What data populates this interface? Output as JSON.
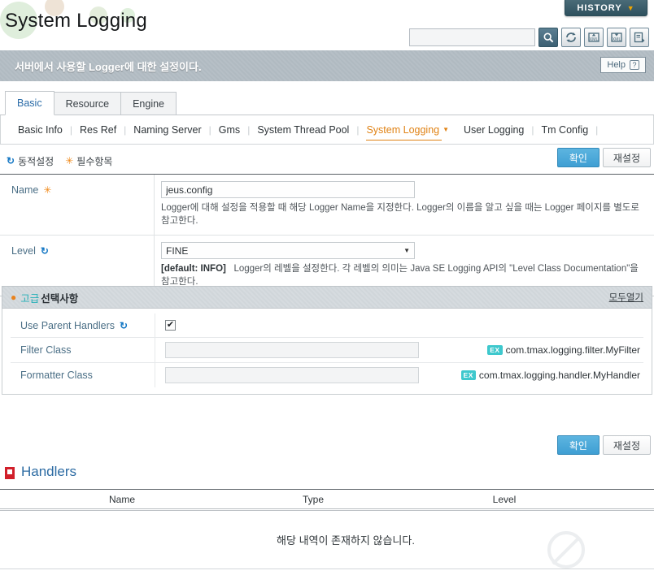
{
  "header": {
    "title": "System Logging",
    "history_label": "HISTORY",
    "history_caret": "▼",
    "search_placeholder": "",
    "search_value": "",
    "toolbar_icons": [
      {
        "name": "search-icon",
        "title": "Search"
      },
      {
        "name": "refresh-icon",
        "title": "Reload"
      },
      {
        "name": "xml-upload-icon",
        "title": "XML Upload"
      },
      {
        "name": "xml-download-icon",
        "title": "XML Download"
      },
      {
        "name": "export-icon",
        "title": "Export"
      }
    ]
  },
  "banner": {
    "text": "서버에서 사용할 Logger에 대한 설정이다.",
    "help_label": "Help",
    "help_mark": "?"
  },
  "tabs": [
    {
      "label": "Basic",
      "active": true
    },
    {
      "label": "Resource",
      "active": false
    },
    {
      "label": "Engine",
      "active": false
    }
  ],
  "subnav": [
    {
      "label": "Basic Info",
      "active": false
    },
    {
      "label": "Res Ref",
      "active": false
    },
    {
      "label": "Naming Server",
      "active": false
    },
    {
      "label": "Gms",
      "active": false
    },
    {
      "label": "System Thread Pool",
      "active": false
    },
    {
      "label": "System Logging",
      "active": true
    },
    {
      "label": "User Logging",
      "active": false
    },
    {
      "label": "Tm Config",
      "active": false
    }
  ],
  "legend": {
    "dynamic_label": "동적설정",
    "required_label": "필수항목",
    "dynamic_icon": "↻",
    "required_icon": "✳"
  },
  "actions": {
    "confirm_label": "확인",
    "reset_label": "재설정"
  },
  "basic_form": {
    "rows": [
      {
        "label": "Name",
        "marker": "required",
        "marker_glyph": "✳",
        "control": "text",
        "value": "jeus.config",
        "default_prefix": "",
        "desc": "Logger에 대해 설정을 적용할 때 해당 Logger Name을 지정한다. Logger의 이름을 알고 싶을 때는 Logger 페이지를 별도로 참고한다."
      },
      {
        "label": "Level",
        "marker": "dynamic",
        "marker_glyph": "↻",
        "control": "select",
        "value": "FINE",
        "default_prefix": "[default: INFO]",
        "desc": "Logger의 레벨을 설정한다. 각 레벨의 의미는 Java SE Logging API의 \"Level Class Documentation\"을 참고한다."
      }
    ]
  },
  "advanced": {
    "icon_name": "bulb-icon",
    "title_highlight": "고급",
    "title_rest": "선택사항",
    "expand_all_label": "모두열기",
    "rows": [
      {
        "label": "Use Parent Handlers",
        "marker_glyph": "↻",
        "control": "checkbox",
        "checked": true,
        "check_glyph": "✔",
        "value": "",
        "example_badge": "",
        "example_text": ""
      },
      {
        "label": "Filter Class",
        "marker_glyph": "",
        "control": "text",
        "checked": false,
        "check_glyph": "",
        "value": "",
        "example_badge": "EX",
        "example_text": "com.tmax.logging.filter.MyFilter"
      },
      {
        "label": "Formatter Class",
        "marker_glyph": "",
        "control": "text",
        "checked": false,
        "check_glyph": "",
        "value": "",
        "example_badge": "EX",
        "example_text": "com.tmax.logging.handler.MyHandler"
      }
    ]
  },
  "handlers": {
    "title": "Handlers",
    "columns": [
      "Name",
      "Type",
      "Level"
    ],
    "rows": [],
    "empty_message": "해당 내역이 존재하지 않습니다."
  },
  "colors": {
    "accent_blue": "#2c6ba3",
    "accent_orange": "#e08214",
    "accent_teal": "#3ec8cd",
    "button_blue": "#3f9fd3",
    "handler_red": "#d11f2a"
  }
}
